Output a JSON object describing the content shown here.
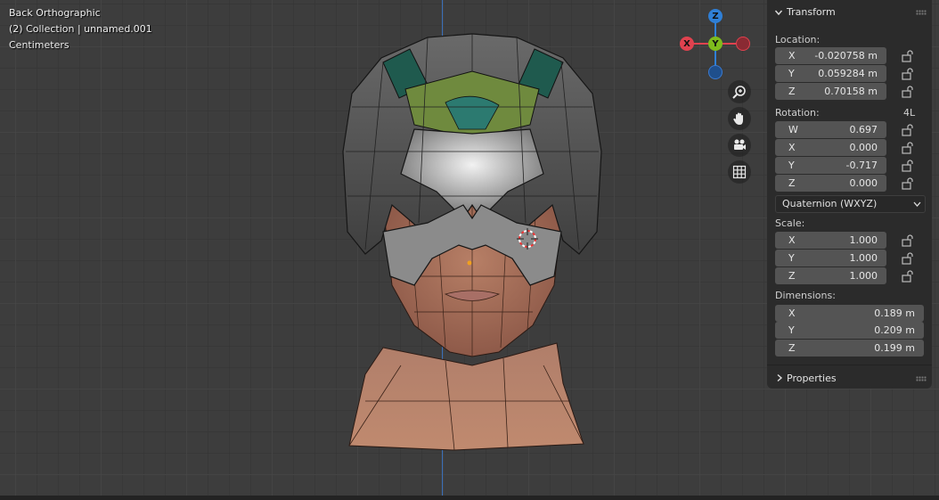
{
  "viewport": {
    "view_name": "Back Orthographic",
    "collection_info": "(2) Collection | unnamed.001",
    "units": "Centimeters"
  },
  "gizmo": {
    "z_label": "Z",
    "y_label": "Y",
    "x_label": "X"
  },
  "colors": {
    "x_axis": "#e0424f",
    "y_axis": "#7ebc1d",
    "z_axis": "#2f7fd6",
    "panel_bg": "#2b2b2b",
    "field_bg": "#545454"
  },
  "nav_tools": [
    "zoom-icon",
    "pan-hand-icon",
    "camera-icon",
    "grid-icon"
  ],
  "panel": {
    "transform_title": "Transform",
    "location_label": "Location:",
    "location": [
      {
        "axis": "X",
        "value": "-0.020758 m"
      },
      {
        "axis": "Y",
        "value": "0.059284 m"
      },
      {
        "axis": "Z",
        "value": "0.70158 m"
      }
    ],
    "rotation_label": "Rotation:",
    "rotation_tag": "4L",
    "rotation": [
      {
        "axis": "W",
        "value": "0.697"
      },
      {
        "axis": "X",
        "value": "0.000"
      },
      {
        "axis": "Y",
        "value": "-0.717"
      },
      {
        "axis": "Z",
        "value": "0.000"
      }
    ],
    "rotation_mode": "Quaternion (WXYZ)",
    "scale_label": "Scale:",
    "scale": [
      {
        "axis": "X",
        "value": "1.000"
      },
      {
        "axis": "Y",
        "value": "1.000"
      },
      {
        "axis": "Z",
        "value": "1.000"
      }
    ],
    "dimensions_label": "Dimensions:",
    "dimensions": [
      {
        "axis": "X",
        "value": "0.189 m"
      },
      {
        "axis": "Y",
        "value": "0.209 m"
      },
      {
        "axis": "Z",
        "value": "0.199 m"
      }
    ],
    "properties_title": "Properties"
  }
}
